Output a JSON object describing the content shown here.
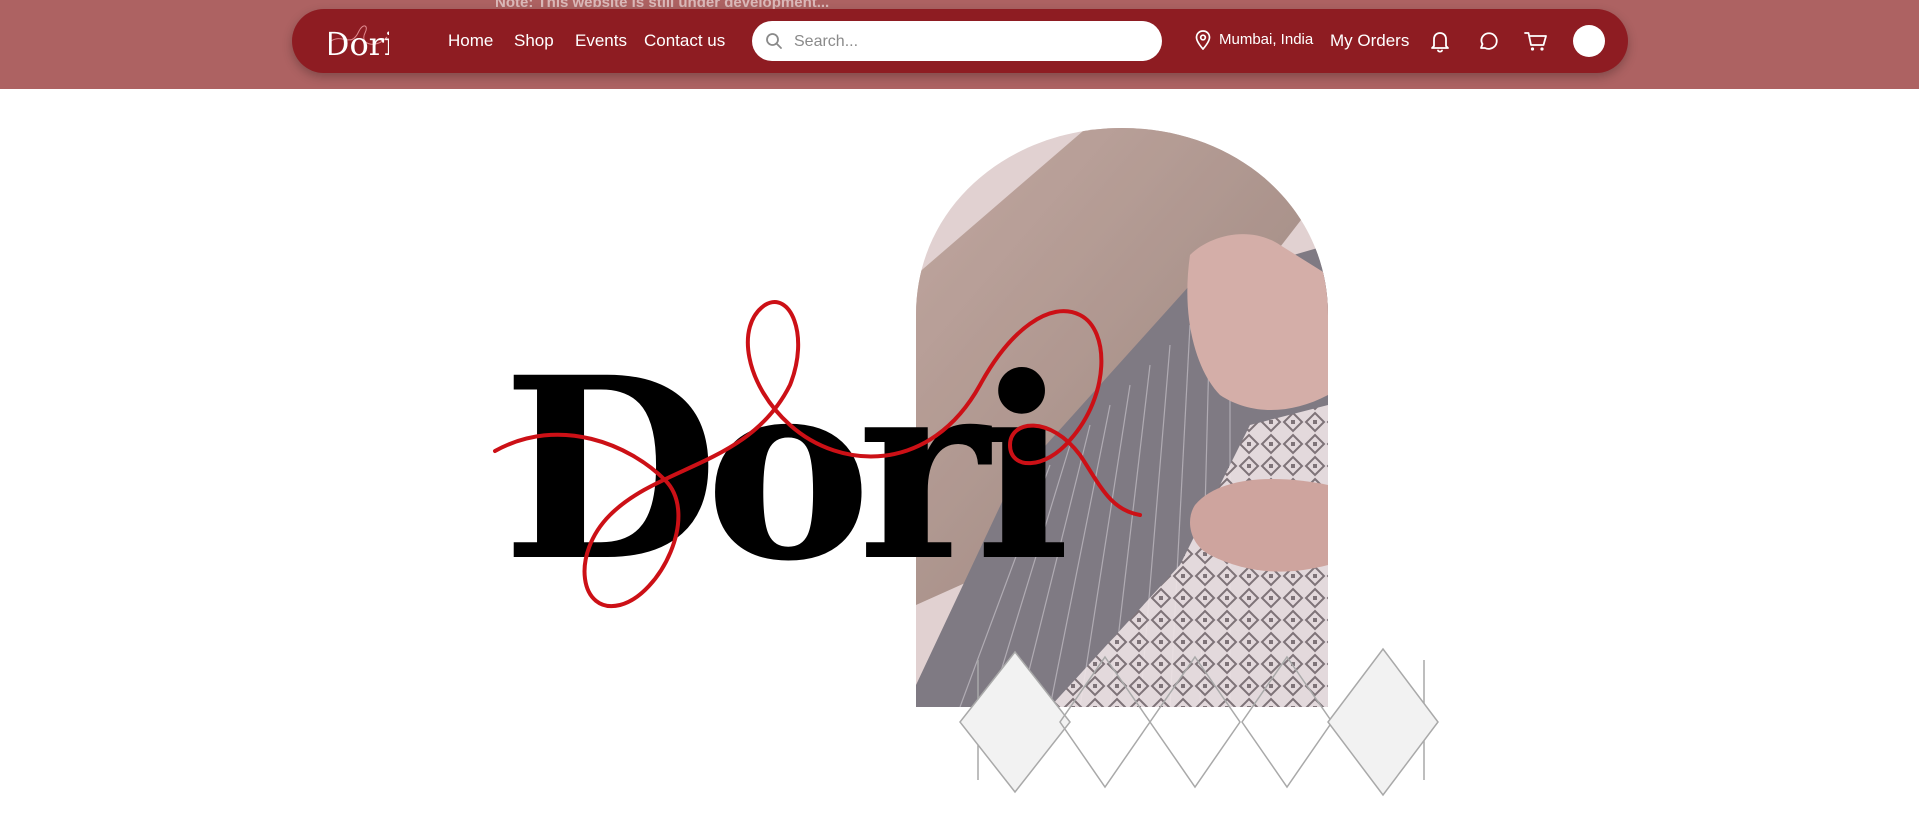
{
  "brand": {
    "logo_text": "Dori"
  },
  "notice_bar": {
    "text": "Note: This website is still under development..."
  },
  "nav": {
    "links": [
      "Home",
      "Shop",
      "Events",
      "Contact us"
    ],
    "search_placeholder": "Search...",
    "location": "Mumbai, India",
    "my_orders": "My Orders",
    "icons": [
      "bell-icon",
      "chat-icon",
      "cart-icon",
      "avatar"
    ]
  },
  "hero": {
    "wordmark": "Dori",
    "image_subject": "hands weaving on a loom",
    "thread_color": "#cc1016"
  },
  "colors": {
    "top_band": "#ad6262",
    "navbar": "#8e1c22",
    "accent_thread": "#cc1016"
  }
}
